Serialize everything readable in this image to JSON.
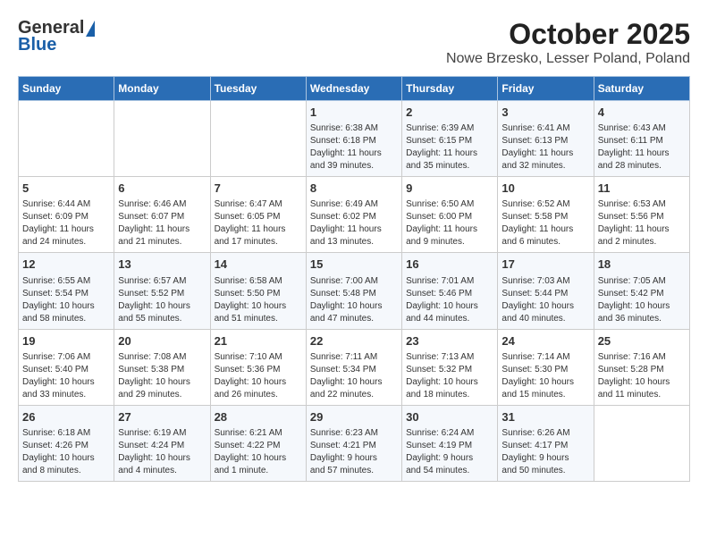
{
  "header": {
    "logo_general": "General",
    "logo_blue": "Blue",
    "title": "October 2025",
    "subtitle": "Nowe Brzesko, Lesser Poland, Poland"
  },
  "days_of_week": [
    "Sunday",
    "Monday",
    "Tuesday",
    "Wednesday",
    "Thursday",
    "Friday",
    "Saturday"
  ],
  "weeks": [
    [
      {
        "day": "",
        "info": ""
      },
      {
        "day": "",
        "info": ""
      },
      {
        "day": "",
        "info": ""
      },
      {
        "day": "1",
        "info": "Sunrise: 6:38 AM\nSunset: 6:18 PM\nDaylight: 11 hours\nand 39 minutes."
      },
      {
        "day": "2",
        "info": "Sunrise: 6:39 AM\nSunset: 6:15 PM\nDaylight: 11 hours\nand 35 minutes."
      },
      {
        "day": "3",
        "info": "Sunrise: 6:41 AM\nSunset: 6:13 PM\nDaylight: 11 hours\nand 32 minutes."
      },
      {
        "day": "4",
        "info": "Sunrise: 6:43 AM\nSunset: 6:11 PM\nDaylight: 11 hours\nand 28 minutes."
      }
    ],
    [
      {
        "day": "5",
        "info": "Sunrise: 6:44 AM\nSunset: 6:09 PM\nDaylight: 11 hours\nand 24 minutes."
      },
      {
        "day": "6",
        "info": "Sunrise: 6:46 AM\nSunset: 6:07 PM\nDaylight: 11 hours\nand 21 minutes."
      },
      {
        "day": "7",
        "info": "Sunrise: 6:47 AM\nSunset: 6:05 PM\nDaylight: 11 hours\nand 17 minutes."
      },
      {
        "day": "8",
        "info": "Sunrise: 6:49 AM\nSunset: 6:02 PM\nDaylight: 11 hours\nand 13 minutes."
      },
      {
        "day": "9",
        "info": "Sunrise: 6:50 AM\nSunset: 6:00 PM\nDaylight: 11 hours\nand 9 minutes."
      },
      {
        "day": "10",
        "info": "Sunrise: 6:52 AM\nSunset: 5:58 PM\nDaylight: 11 hours\nand 6 minutes."
      },
      {
        "day": "11",
        "info": "Sunrise: 6:53 AM\nSunset: 5:56 PM\nDaylight: 11 hours\nand 2 minutes."
      }
    ],
    [
      {
        "day": "12",
        "info": "Sunrise: 6:55 AM\nSunset: 5:54 PM\nDaylight: 10 hours\nand 58 minutes."
      },
      {
        "day": "13",
        "info": "Sunrise: 6:57 AM\nSunset: 5:52 PM\nDaylight: 10 hours\nand 55 minutes."
      },
      {
        "day": "14",
        "info": "Sunrise: 6:58 AM\nSunset: 5:50 PM\nDaylight: 10 hours\nand 51 minutes."
      },
      {
        "day": "15",
        "info": "Sunrise: 7:00 AM\nSunset: 5:48 PM\nDaylight: 10 hours\nand 47 minutes."
      },
      {
        "day": "16",
        "info": "Sunrise: 7:01 AM\nSunset: 5:46 PM\nDaylight: 10 hours\nand 44 minutes."
      },
      {
        "day": "17",
        "info": "Sunrise: 7:03 AM\nSunset: 5:44 PM\nDaylight: 10 hours\nand 40 minutes."
      },
      {
        "day": "18",
        "info": "Sunrise: 7:05 AM\nSunset: 5:42 PM\nDaylight: 10 hours\nand 36 minutes."
      }
    ],
    [
      {
        "day": "19",
        "info": "Sunrise: 7:06 AM\nSunset: 5:40 PM\nDaylight: 10 hours\nand 33 minutes."
      },
      {
        "day": "20",
        "info": "Sunrise: 7:08 AM\nSunset: 5:38 PM\nDaylight: 10 hours\nand 29 minutes."
      },
      {
        "day": "21",
        "info": "Sunrise: 7:10 AM\nSunset: 5:36 PM\nDaylight: 10 hours\nand 26 minutes."
      },
      {
        "day": "22",
        "info": "Sunrise: 7:11 AM\nSunset: 5:34 PM\nDaylight: 10 hours\nand 22 minutes."
      },
      {
        "day": "23",
        "info": "Sunrise: 7:13 AM\nSunset: 5:32 PM\nDaylight: 10 hours\nand 18 minutes."
      },
      {
        "day": "24",
        "info": "Sunrise: 7:14 AM\nSunset: 5:30 PM\nDaylight: 10 hours\nand 15 minutes."
      },
      {
        "day": "25",
        "info": "Sunrise: 7:16 AM\nSunset: 5:28 PM\nDaylight: 10 hours\nand 11 minutes."
      }
    ],
    [
      {
        "day": "26",
        "info": "Sunrise: 6:18 AM\nSunset: 4:26 PM\nDaylight: 10 hours\nand 8 minutes."
      },
      {
        "day": "27",
        "info": "Sunrise: 6:19 AM\nSunset: 4:24 PM\nDaylight: 10 hours\nand 4 minutes."
      },
      {
        "day": "28",
        "info": "Sunrise: 6:21 AM\nSunset: 4:22 PM\nDaylight: 10 hours\nand 1 minute."
      },
      {
        "day": "29",
        "info": "Sunrise: 6:23 AM\nSunset: 4:21 PM\nDaylight: 9 hours\nand 57 minutes."
      },
      {
        "day": "30",
        "info": "Sunrise: 6:24 AM\nSunset: 4:19 PM\nDaylight: 9 hours\nand 54 minutes."
      },
      {
        "day": "31",
        "info": "Sunrise: 6:26 AM\nSunset: 4:17 PM\nDaylight: 9 hours\nand 50 minutes."
      },
      {
        "day": "",
        "info": ""
      }
    ]
  ]
}
